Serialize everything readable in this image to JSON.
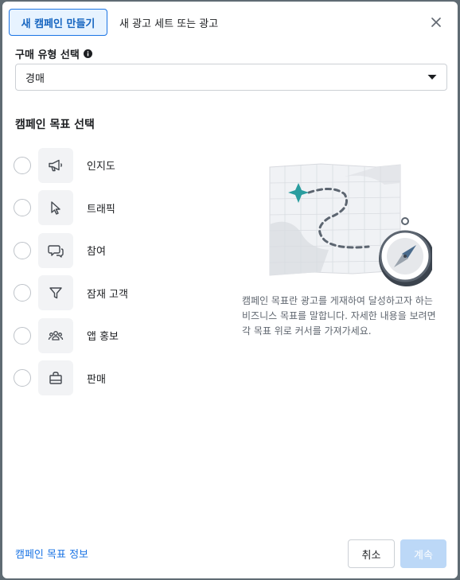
{
  "header": {
    "active_tab": "새 캠페인 만들기",
    "inactive_tab": "새 광고 세트 또는 광고",
    "close_icon": "close-icon"
  },
  "buying_type": {
    "label": "구매 유형 선택",
    "info_icon": "info-icon",
    "selected": "경매"
  },
  "objective_section": {
    "title": "캠페인 목표 선택",
    "items": [
      {
        "label": "인지도",
        "icon": "megaphone-icon"
      },
      {
        "label": "트래픽",
        "icon": "cursor-icon"
      },
      {
        "label": "참여",
        "icon": "chat-bubble-icon"
      },
      {
        "label": "잠재 고객",
        "icon": "funnel-icon"
      },
      {
        "label": "앱 홍보",
        "icon": "people-icon"
      },
      {
        "label": "판매",
        "icon": "shopping-bag-icon"
      }
    ],
    "description": "캠페인 목표란 광고를 게재하여 달성하고자 하는 비즈니스 목표를 말합니다. 자세한 내용을 보려면 각 목표 위로 커서를 가져가세요."
  },
  "footer": {
    "info_link": "캠페인 목표 정보",
    "cancel_label": "취소",
    "continue_label": "계속"
  },
  "colors": {
    "accent": "#1b74e4",
    "active_tab_bg": "#e7f3ff",
    "disabled_button": "#bcd8f7",
    "illustration_teal": "#2a9d9f"
  }
}
